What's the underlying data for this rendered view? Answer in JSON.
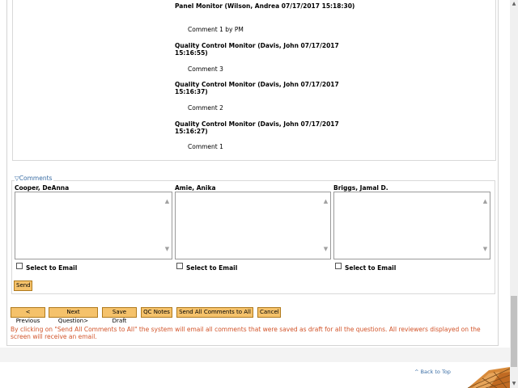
{
  "history": [
    {
      "head": "Panel Monitor (Wilson, Andrea 07/17/2017 15:18:30)",
      "body": "Comment 1 by PM"
    },
    {
      "head": "Quality Control Monitor (Davis, John 07/17/2017 15:16:55)",
      "body": "Comment 3"
    },
    {
      "head": "Quality Control Monitor (Davis, John 07/17/2017 15:16:37)",
      "body": "Comment 2"
    },
    {
      "head": "Quality Control Monitor (Davis, John 07/17/2017 15:16:27)",
      "body": "Comment 1"
    }
  ],
  "comments": {
    "legend": "Comments",
    "reviewers": [
      {
        "name": "Cooper, DeAnna",
        "email_label": "Select to Email"
      },
      {
        "name": "Amie, Anika",
        "email_label": "Select to Email"
      },
      {
        "name": "Briggs, Jamal D.",
        "email_label": "Select to Email"
      }
    ],
    "send_label": "Send"
  },
  "actions": {
    "previous": "< Previous",
    "next": "Next Question>",
    "save_draft": "Save Draft",
    "qc_notes": "QC Notes",
    "send_all": "Send All Comments to All",
    "cancel": "Cancel"
  },
  "notice": "By clicking on \"Send All Comments to All\" the system will email all comments that were saved as draft for all the questions. All reviewers displayed on the screen will receive an email.",
  "back_to_top": "^ Back to Top",
  "colors": {
    "button": "#f5c26b",
    "notice": "#d2542a",
    "link": "#3b6ea5"
  }
}
